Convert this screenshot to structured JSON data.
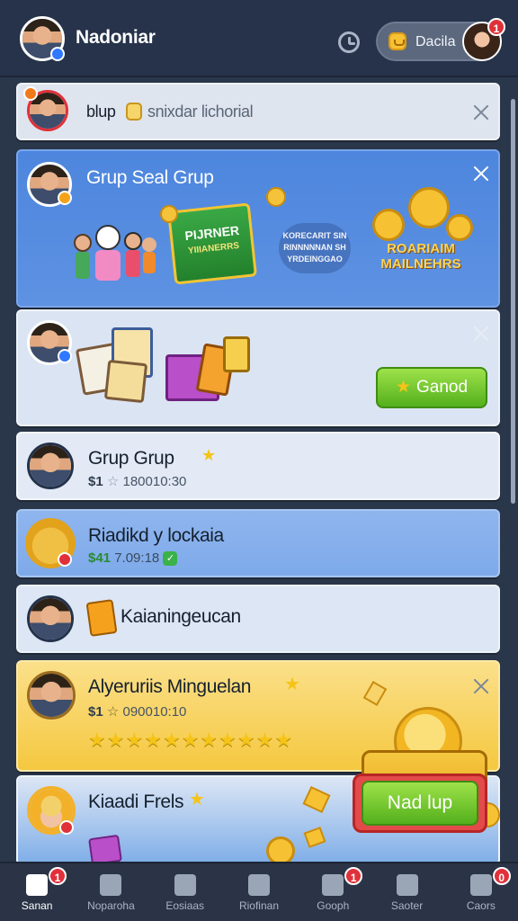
{
  "header": {
    "user_name": "Nadoniar",
    "coin_label": "Dacila",
    "pill_notification": "1"
  },
  "feed": {
    "card1": {
      "text_a": "blup",
      "text_b": "snixdar lichorial"
    },
    "card2": {
      "title": "Grup Seal Grup",
      "sign_title": "PIJRNER",
      "sign_sub": "YIIIANERRS",
      "mid_text": "KORECARIT SINRINNNNNAN SHYRDEINGGAO",
      "badge_text": "ROARIAIM MAILNEHRS"
    },
    "card3": {
      "button_label": "Ganod"
    },
    "card4": {
      "title": "Grup Grup",
      "meta_prefix": "$1",
      "meta_time": "180010:30"
    },
    "card5": {
      "title": "Riadikd y lockaia",
      "meta_prefix": "$41",
      "meta_time": "7.09:18"
    },
    "card6": {
      "title": "Kaianingeucan"
    },
    "card7": {
      "title": "Alyeruriis Minguelan",
      "meta_prefix": "$1",
      "meta_time": "090010:10",
      "rating": 11
    },
    "card8": {
      "title": "Kiaadi Frels",
      "button_label": "Nad lup"
    }
  },
  "bottom_nav": [
    {
      "label": "Sanan",
      "badge": "1",
      "icon": "home-icon",
      "active": true
    },
    {
      "label": "Noparoha",
      "badge": "",
      "icon": "list-icon",
      "active": false
    },
    {
      "label": "Eosiaas",
      "badge": "",
      "icon": "trophy-icon",
      "active": false
    },
    {
      "label": "Riofinan",
      "badge": "",
      "icon": "chat-icon",
      "active": false
    },
    {
      "label": "Gooph",
      "badge": "1",
      "icon": "group-icon",
      "active": false
    },
    {
      "label": "Saoter",
      "badge": "",
      "icon": "picture-icon",
      "active": false
    },
    {
      "label": "Caors",
      "badge": "0",
      "icon": "friends-icon",
      "active": false
    }
  ],
  "colors": {
    "header_bg": "#26334a",
    "card_blue": "#4f86d9",
    "card_light": "#dce6f5",
    "card_gold": "#f6cf4e",
    "accent_green": "#53b01c",
    "notification_red": "#e0313a"
  }
}
